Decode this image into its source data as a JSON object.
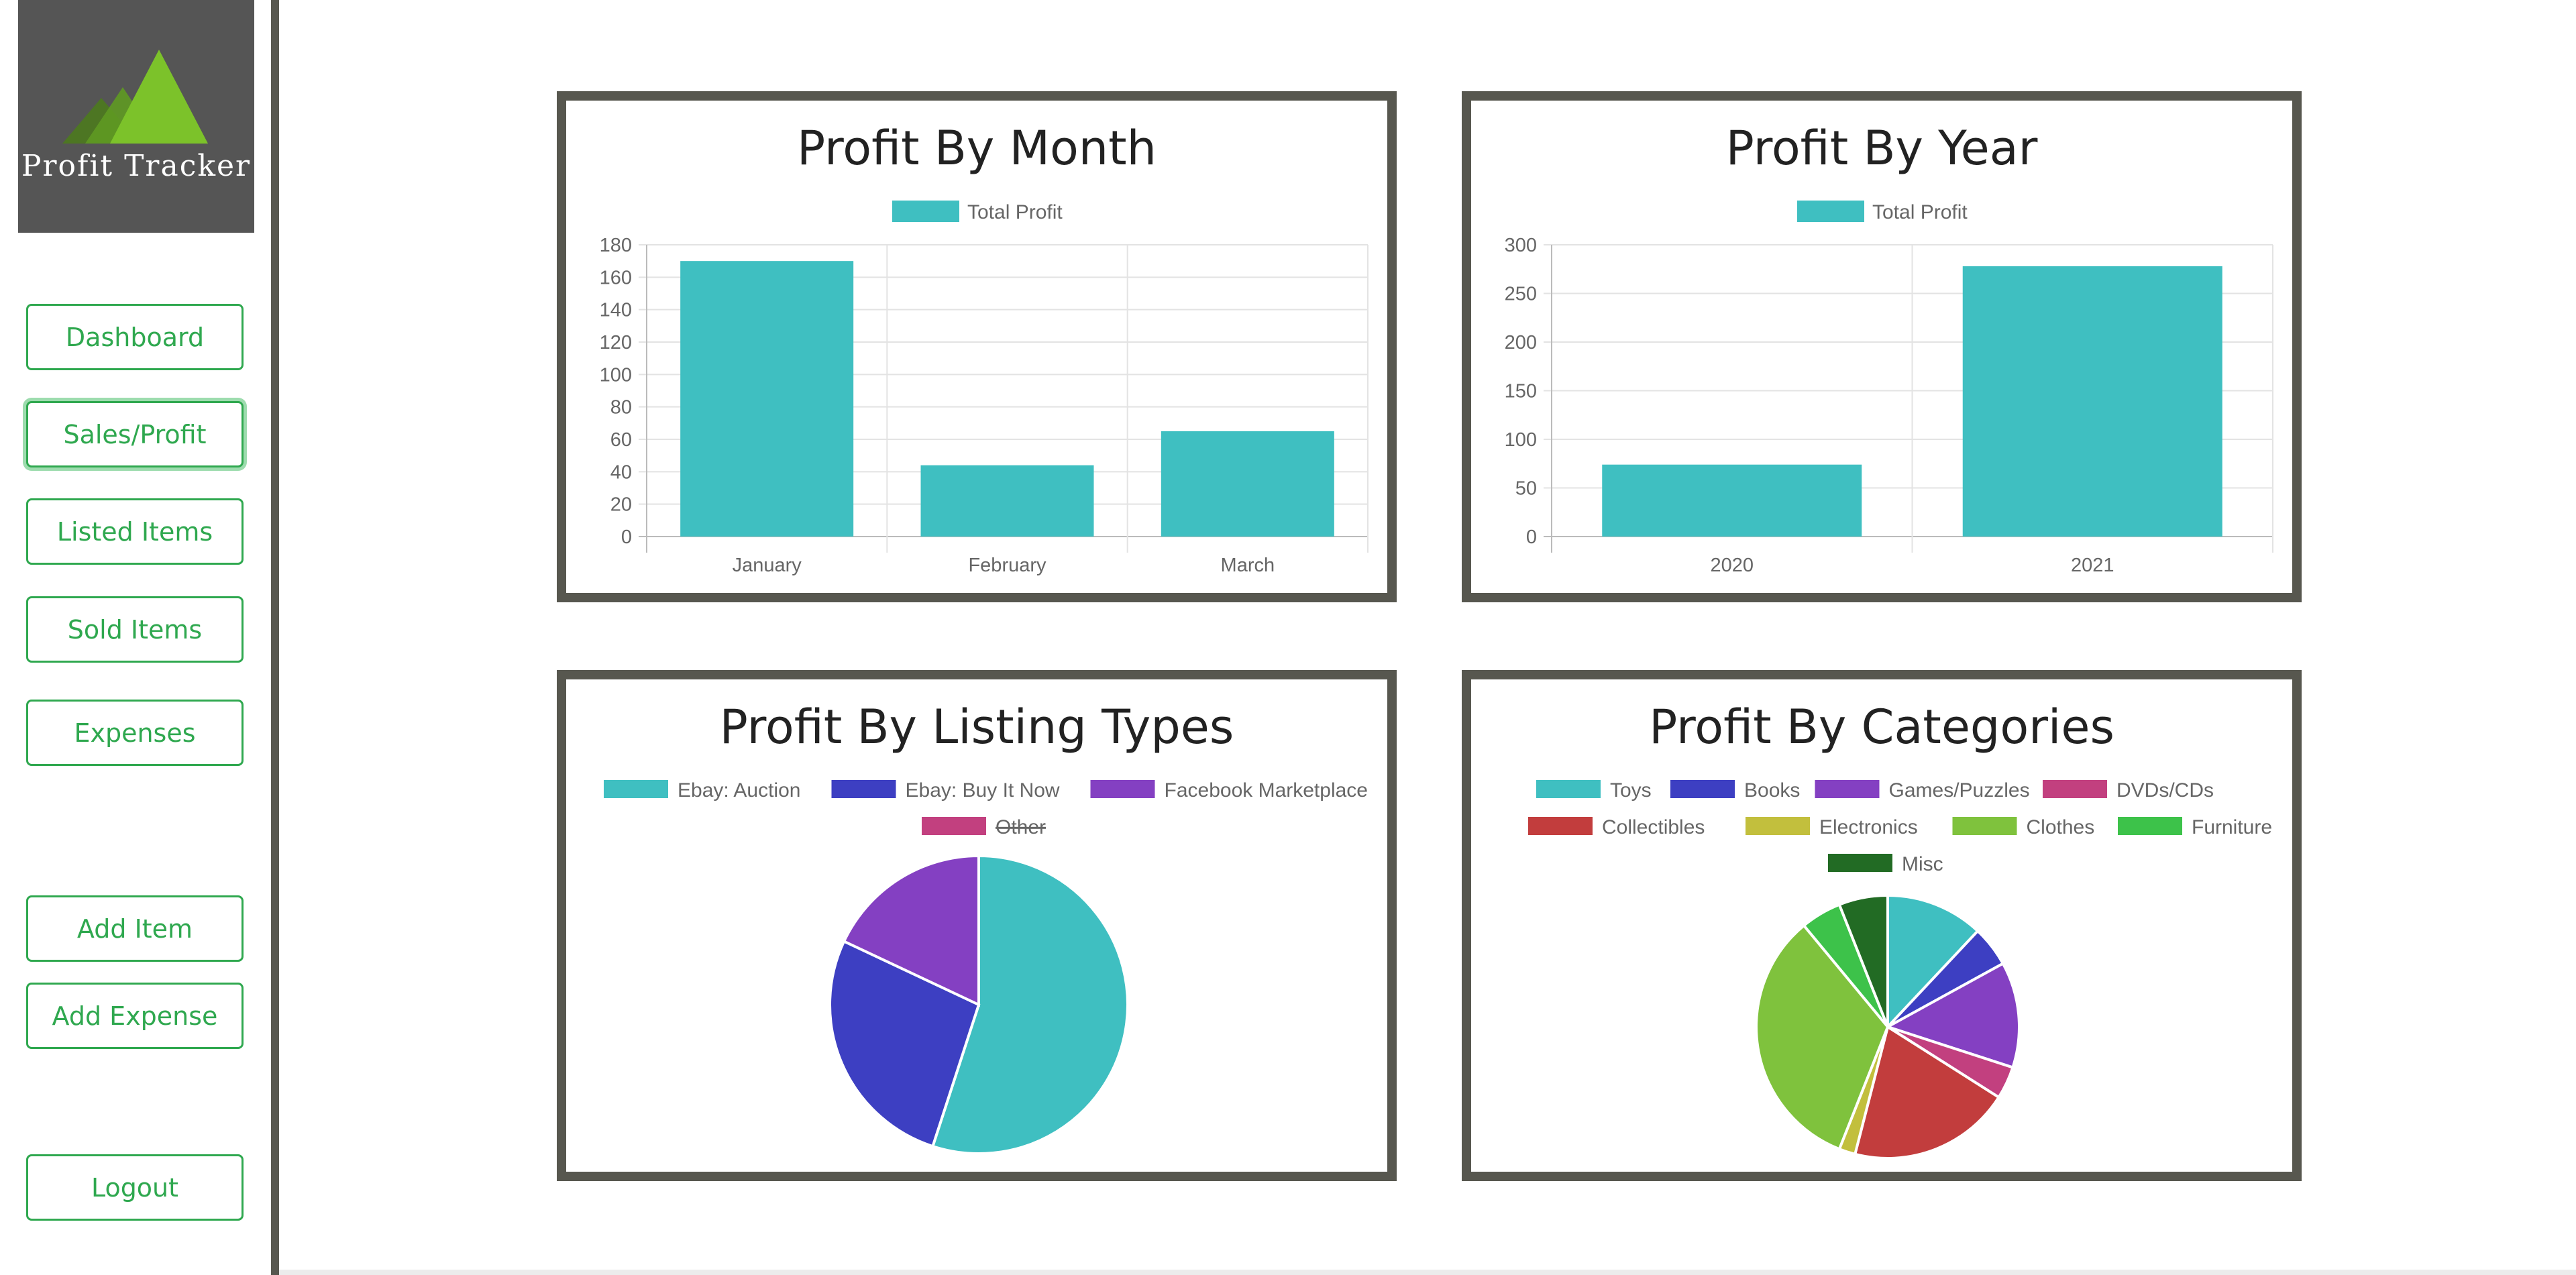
{
  "app": {
    "brand": "Profit Tracker"
  },
  "nav": {
    "dashboard": "Dashboard",
    "sales_profit": "Sales/Profit",
    "listed_items": "Listed Items",
    "sold_items": "Sold Items",
    "expenses": "Expenses",
    "add_item": "Add Item",
    "add_expense": "Add Expense",
    "logout": "Logout"
  },
  "colors": {
    "teal": "#3fbfc1",
    "blue": "#3d3fc2",
    "purple": "#8440c2",
    "pink": "#c2407f",
    "red": "#c23d3d",
    "olive": "#c2bf3d",
    "lime": "#7fc23d",
    "green": "#3dc24a",
    "darkgreen": "#226b24",
    "nav_green": "#2fa84f",
    "frame": "#57574f"
  },
  "cards": {
    "month_title": "Profit By Month",
    "year_title": "Profit By Year",
    "listing_title": "Profit By Listing Types",
    "category_title": "Profit By Categories"
  },
  "chart_data": [
    {
      "type": "bar",
      "title": "Profit By Month",
      "categories": [
        "January",
        "February",
        "March"
      ],
      "series": [
        {
          "name": "Total Profit",
          "values": [
            170,
            44,
            65
          ]
        }
      ],
      "ylim": [
        0,
        180
      ],
      "yticks": [
        0,
        20,
        40,
        60,
        80,
        100,
        120,
        140,
        160,
        180
      ],
      "grid": true,
      "legend": "top",
      "color": "#3fbfc1"
    },
    {
      "type": "bar",
      "title": "Profit By Year",
      "categories": [
        "2020",
        "2021"
      ],
      "series": [
        {
          "name": "Total Profit",
          "values": [
            74,
            278
          ]
        }
      ],
      "ylim": [
        0,
        300
      ],
      "yticks": [
        0,
        50,
        100,
        150,
        200,
        250,
        300
      ],
      "grid": true,
      "legend": "top",
      "color": "#3fbfc1"
    },
    {
      "type": "pie",
      "title": "Profit By Listing Types",
      "legend": "top",
      "slices": [
        {
          "label": "Ebay: Auction",
          "value": 55,
          "color": "#3fbfc1",
          "hidden": false
        },
        {
          "label": "Ebay: Buy It Now",
          "value": 27,
          "color": "#3d3fc2",
          "hidden": false
        },
        {
          "label": "Facebook Marketplace",
          "value": 18,
          "color": "#8440c2",
          "hidden": false
        },
        {
          "label": "Other",
          "value": 0,
          "color": "#c2407f",
          "hidden": true
        }
      ]
    },
    {
      "type": "pie",
      "title": "Profit By Categories",
      "legend": "top",
      "slices": [
        {
          "label": "Toys",
          "value": 12,
          "color": "#3fbfc1"
        },
        {
          "label": "Books",
          "value": 5,
          "color": "#3d3fc2"
        },
        {
          "label": "Games/Puzzles",
          "value": 13,
          "color": "#8440c2"
        },
        {
          "label": "DVDs/CDs",
          "value": 4,
          "color": "#c2407f"
        },
        {
          "label": "Collectibles",
          "value": 20,
          "color": "#c23d3d"
        },
        {
          "label": "Electronics",
          "value": 2,
          "color": "#c2bf3d"
        },
        {
          "label": "Clothes",
          "value": 33,
          "color": "#7fc23d"
        },
        {
          "label": "Furniture",
          "value": 5,
          "color": "#3dc24a"
        },
        {
          "label": "Misc",
          "value": 6,
          "color": "#226b24"
        }
      ]
    }
  ]
}
